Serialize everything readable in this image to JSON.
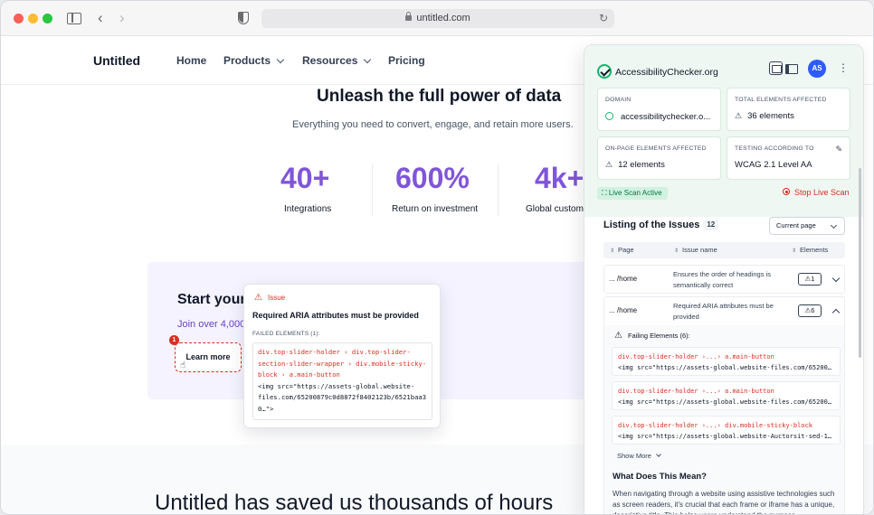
{
  "browser": {
    "url": "untitled.com"
  },
  "site": {
    "logo": "Untitled",
    "nav": [
      "Home",
      "Products",
      "Resources",
      "Pricing"
    ],
    "hero_title": "Unleash the full power of data",
    "hero_subtitle": "Everything you need to convert, engage, and retain more users.",
    "stats": [
      {
        "value": "40+",
        "label": "Integrations"
      },
      {
        "value": "600%",
        "label": "Return on investment"
      },
      {
        "value": "4k+",
        "label": "Global custom"
      }
    ],
    "cta_title": "Start your",
    "cta_subtitle": "Join over 4,000",
    "cta_button": "Learn more",
    "cta_badge": "1",
    "bottom_title": "Untitled has saved us thousands of hours"
  },
  "issue_popup": {
    "header": "Issue",
    "title": "Required ARIA attributes must be provided",
    "failed_label": "FAILED ELEMENTS (1):",
    "selector_lines": [
      "div.top-slider-holder › div.top-slider-",
      "section-slider-wrapper › div.mobile-sticky-",
      "block › a.main-button"
    ],
    "code_lines": [
      "<img src=\"https://assets-global.website-",
      "files.com/65200879c0d8872f8402123b/6521baa3",
      "0…\">"
    ]
  },
  "extension": {
    "logo": "AccessibilityChecker.org",
    "avatar": "AS",
    "cards": [
      {
        "label": "DOMAIN",
        "value": "accessibilitychecker.o..."
      },
      {
        "label": "TOTAL ELEMENTS AFFECTED",
        "value": "36 elements"
      },
      {
        "label": "ON-PAGE ELEMENTS AFFECTED",
        "value": "12 elements"
      },
      {
        "label": "TESTING ACCORDING TO",
        "value": "WCAG 2.1 Level AA"
      }
    ],
    "live_status": "Live Scan Active",
    "stop_label": "Stop Live Scan",
    "list_title": "Listing of the Issues",
    "list_count": "12",
    "page_filter": "Current page",
    "columns": [
      "Page",
      "Issue name",
      "Elements"
    ],
    "rows": [
      {
        "page": "... /home",
        "issue": "Ensures the order of headings is semantically correct",
        "count": "1"
      },
      {
        "page": "... /home",
        "issue": "Required ARIA attributes must be provided",
        "count": "6"
      }
    ],
    "failing_label": "Failing Elements (6):",
    "failing_elements": [
      {
        "selector_prefix": "div.top-slider-holder ›...› ",
        "selector_target": "a.main-button",
        "code": "<img src=\"https://assets-global.website-files.com/65200…"
      },
      {
        "selector_prefix": "div.top-slider-holder ›...› ",
        "selector_target": "a.main-button",
        "code": "<img src=\"https://assets-global.website-files.com/65200…"
      },
      {
        "selector_prefix": "div.top-slider-holder ›...› ",
        "selector_target": "div.mobile-sticky-block",
        "code": "<img src=\"https://assets-global.website-Auctorsit-sed-1…"
      }
    ],
    "show_more": "Show More",
    "meaning_title": "What Does This Mean?",
    "meaning_body": "When navigating through a website using assistive technologies such as screen readers, it's crucial that each frame or iframe has a unique, descriptive title. This helps users understand the purpose"
  }
}
